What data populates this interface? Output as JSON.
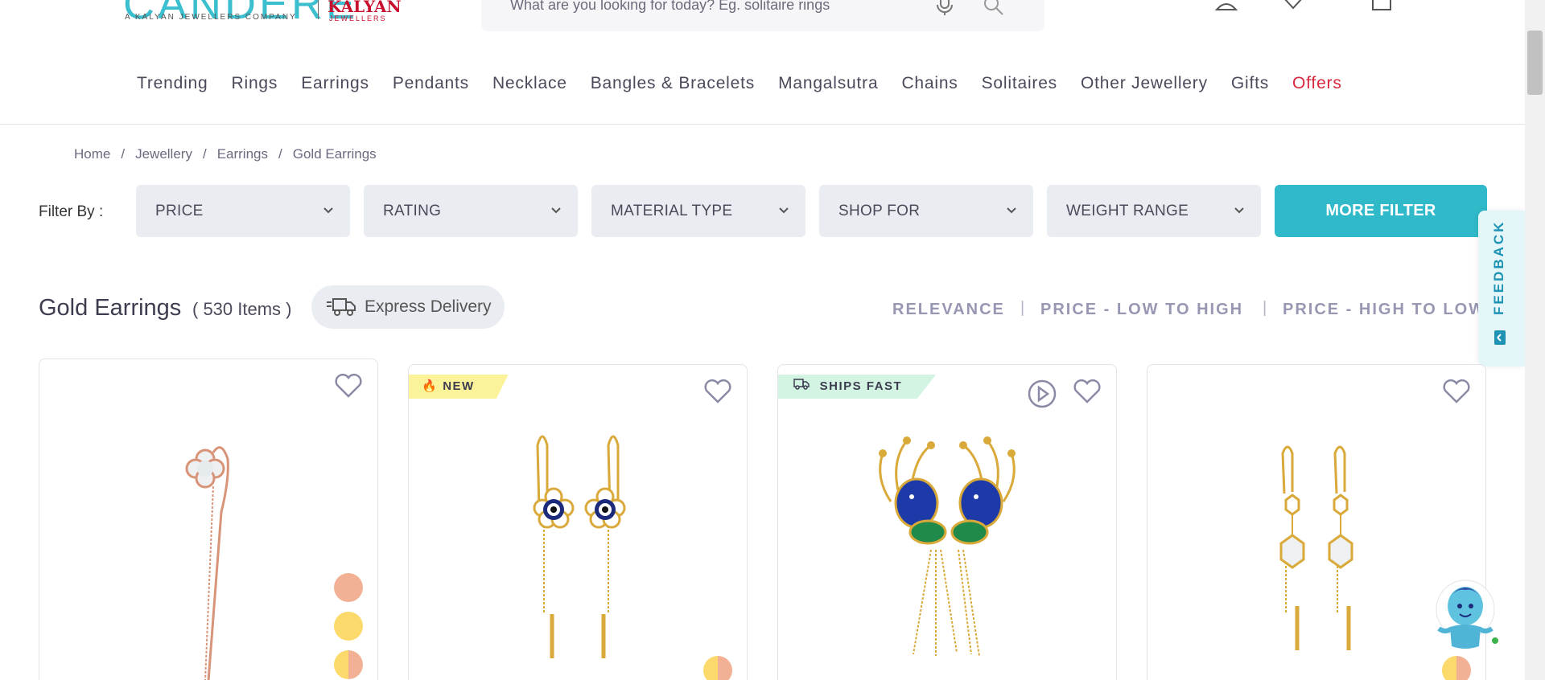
{
  "header": {
    "logo_main": "CANDERE",
    "logo_sub": "A KALYAN JEWELLERS COMPANY",
    "logo_partner": "KALYAN",
    "logo_partner_sub": "JEWELLERS",
    "search_placeholder": "What are you looking for today? Eg. solitaire rings"
  },
  "nav": {
    "items": [
      "Trending",
      "Rings",
      "Earrings",
      "Pendants",
      "Necklace",
      "Bangles & Bracelets",
      "Mangalsutra",
      "Chains",
      "Solitaires",
      "Other Jewellery",
      "Gifts",
      "Offers"
    ]
  },
  "breadcrumb": [
    "Home",
    "Jewellery",
    "Earrings",
    "Gold Earrings"
  ],
  "filters": {
    "label": "Filter By :",
    "items": [
      "PRICE",
      "RATING",
      "MATERIAL TYPE",
      "SHOP FOR",
      "WEIGHT RANGE"
    ],
    "more": "MORE FILTER"
  },
  "listing": {
    "title": "Gold Earrings",
    "count": "( 530 Items )",
    "express": "Express Delivery"
  },
  "sort": {
    "options": [
      "RELEVANCE",
      "PRICE - LOW TO HIGH",
      "PRICE - HIGH TO LOW"
    ]
  },
  "feedback": {
    "label": "FEEDBACK"
  },
  "products": [
    {
      "badge": "",
      "swatches": [
        "rose",
        "yellow",
        "yellow-rose"
      ]
    },
    {
      "badge": "NEW",
      "swatches": [
        "yellow-rose"
      ]
    },
    {
      "badge": "SHIPS FAST",
      "swatches": []
    },
    {
      "badge": "",
      "swatches": [
        "yellow-rose"
      ]
    }
  ],
  "colors": {
    "accent": "#30b9c9",
    "offers": "#d7263d",
    "rose": "#f2b095",
    "yellow": "#fbd96b"
  }
}
